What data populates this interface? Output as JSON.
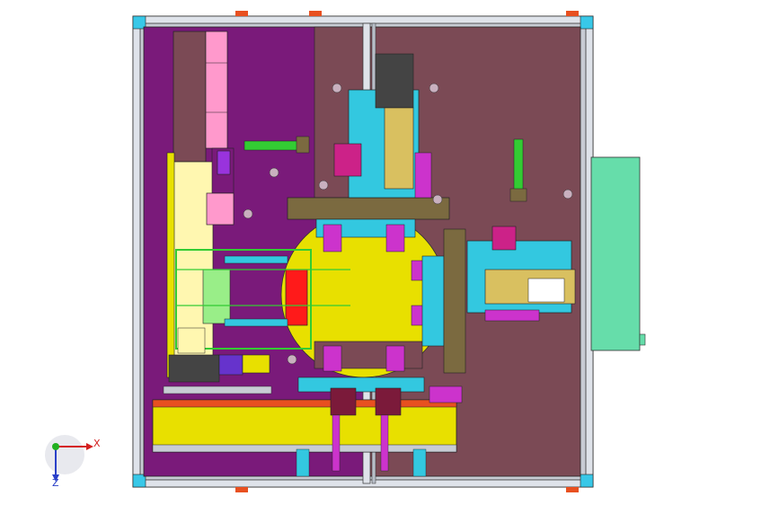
{
  "view": {
    "background": "#ffffff",
    "frame_color": "#b8bec8",
    "plate_left_color": "#7a1a7a",
    "plate_right_color": "#7b4a55",
    "dial_color": "#e8e000",
    "side_panel_color": "#66ddaa",
    "accent_colors": [
      "#e8e000",
      "#ff99cc",
      "#33c8e0",
      "#ff1a1a",
      "#cc33cc",
      "#33cc33"
    ]
  },
  "axes": {
    "x_label": "X",
    "z_label": "Z",
    "x_color": "#d42020",
    "y_color": "#20b020",
    "z_color": "#2a40c8"
  }
}
